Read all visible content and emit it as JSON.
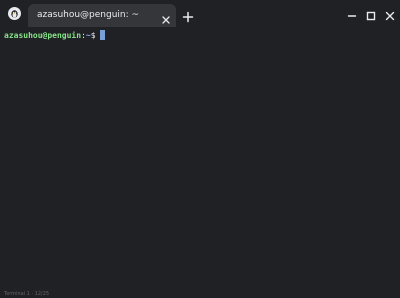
{
  "window": {
    "tab": {
      "title": "azasuhou@penguin: ~",
      "close_icon": "close-icon"
    },
    "app_icon": "penguin-icon",
    "new_tab_icon": "plus-icon",
    "controls": {
      "minimize_icon": "minimize-icon",
      "maximize_icon": "maximize-icon",
      "close_icon": "close-icon"
    }
  },
  "terminal": {
    "prompt": {
      "user_host": "azasuhou@penguin",
      "colon": ":",
      "path": "~",
      "dollar": "$"
    }
  },
  "statusbar": {
    "text": "Terminal 1 · 12/25"
  },
  "colors": {
    "background": "#202124",
    "tab_active": "#35363a",
    "prompt_user": "#87e38a",
    "prompt_path": "#8ab4f8",
    "text": "#e8eaed"
  }
}
